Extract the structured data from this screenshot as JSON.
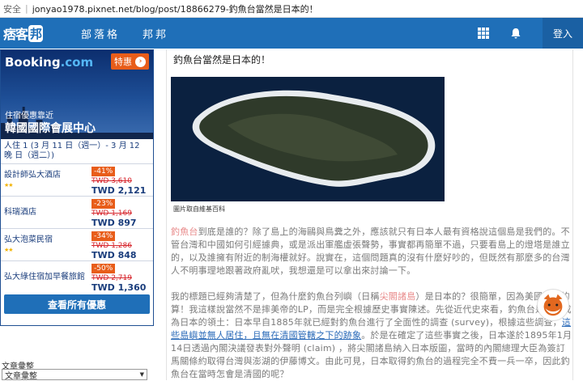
{
  "browser": {
    "secure_label": "安全",
    "url": "jonyao1978.pixnet.net/blog/post/18866279-釣魚台當然是日本的！"
  },
  "nav": {
    "logo_text": "痞客",
    "logo_box": "邦",
    "items": [
      "部落格",
      "邦邦"
    ],
    "login": "登入"
  },
  "ad": {
    "brand": "Booking",
    "brand_suffix": ".com",
    "promo": "特惠",
    "area": "住宿優惠靠近",
    "venue": "韓國國際會展中心",
    "dates_line": "人住 1 (3 月 11 日（週一）- 3 月 12",
    "dates_line2": "晚 日（週二）)",
    "hotels": [
      {
        "name": "設計師弘大酒店",
        "stars": "★★",
        "discount": "-41%",
        "old": "TWD 3,610",
        "new": "TWD 2,121"
      },
      {
        "name": "科瑞酒店",
        "stars": "",
        "discount": "-23%",
        "old": "TWD 1,169",
        "new": "TWD 897"
      },
      {
        "name": "弘大泡菜民宿",
        "stars": "★★",
        "discount": "-34%",
        "old": "TWD 1,286",
        "new": "TWD 848"
      },
      {
        "name": "弘大綠住宿加早餐旅館",
        "stars": "",
        "discount": "-50%",
        "old": "TWD 2,719",
        "new": "TWD 1,360"
      }
    ],
    "cta": "查看所有優惠"
  },
  "sidebar": {
    "category_label": "文章彙整",
    "category_value": "文章彙整"
  },
  "article": {
    "title": "釣魚台當然是日本的！",
    "caption": "圖片取自維基百科",
    "p1_hl": "釣魚台",
    "p1": "到底是誰的？除了島上的海鷗與鳥糞之外，應該就只有日本人最有資格說這個島是我們的。不管台灣和中國如何引經據典，或是派出軍艦虛張聲勢，事實都再簡單不過，只要看島上的燈塔是誰立的，以及誰擁有附近的制海權就好。說實在，這個問題真的沒有什麼好吵的，但既然有那麼多的台灣人不明事理地跟著政府亂吠，我想還是可以拿出來討論一下。",
    "p2_a": "我的標題已經夠清楚了，但為什麼釣魚台列嶼（日稱",
    "p2_hl": "尖閣諸島",
    "p2_b": "）是日本的？很簡單，因為美國人說的算！我這樣說當然不是摔美帝的LP，而是完全根據歷史事實陳述。先從近代史來看，釣魚台是如何成為日本的領土：日本早自1885年就已經對釣魚台進行了全面性的調查 (survey)，根據這些調查，",
    "p2_link": "這些島嶼並無人居住，且無在清國管轄之下的跡象",
    "p2_c": "。於是在確定了這些事實之後，日本遂於1895年1月14日透過內閣決議發表對外聲明 (claim) ，將尖閣諸島納入日本版圖，當時的內閣總理大臣為簽訂馬關條約取得台灣與澎湖的伊藤博文。由此可見，日本取得釣魚台的過程完全不費一兵一卒，因此釣魚台在當時怎會是清國的呢？"
  }
}
